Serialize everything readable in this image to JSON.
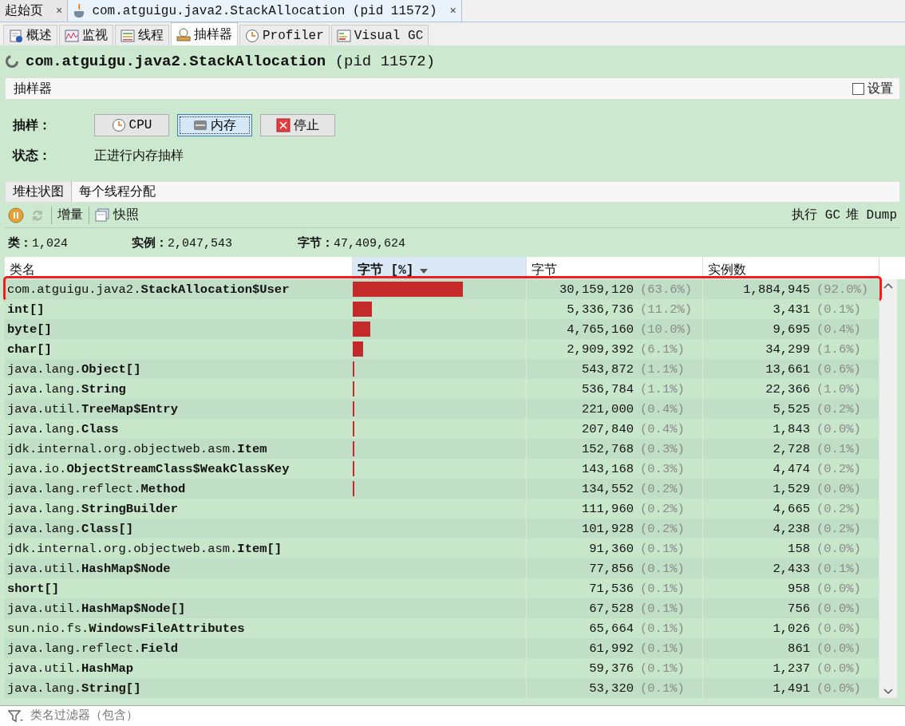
{
  "doc_tabs": [
    {
      "label": "起始页",
      "icon": false,
      "close": "×",
      "selected": false
    },
    {
      "label": "com.atguigu.java2.StackAllocation (pid 11572)",
      "icon": true,
      "close": "×",
      "selected": true
    }
  ],
  "view_tabs": [
    {
      "label": "概述",
      "kind": "info",
      "selected": false
    },
    {
      "label": "监视",
      "kind": "monitor",
      "selected": false
    },
    {
      "label": "线程",
      "kind": "threads",
      "selected": false
    },
    {
      "label": "抽样器",
      "kind": "sampler",
      "selected": true
    },
    {
      "label": "Profiler",
      "kind": "clock",
      "selected": false
    },
    {
      "label": "Visual GC",
      "kind": "gc",
      "selected": false
    }
  ],
  "title": "**com.atguigu.java2.StackAllocation** (pid 11572)",
  "section": {
    "title": "抽样器",
    "settings": {
      "label": "设置",
      "checked": false
    }
  },
  "sampling": {
    "label": "抽样：",
    "buttons": [
      {
        "label": "CPU",
        "kind": "cpu",
        "selected": false
      },
      {
        "label": "内存",
        "kind": "memory",
        "selected": true
      },
      {
        "label": "停止",
        "kind": "stop",
        "selected": false
      }
    ]
  },
  "status": {
    "label": "状态：",
    "value": "正进行内存抽样"
  },
  "result_tabs": [
    {
      "label": "堆柱状图",
      "selected": true
    },
    {
      "label": "每个线程分配",
      "selected": false
    }
  ],
  "toolbar": {
    "left": [
      {
        "kind": "pause",
        "disabled": false
      },
      {
        "kind": "refresh",
        "disabled": true
      },
      {
        "kind": "separator"
      },
      {
        "kind": "text",
        "label": "增量"
      },
      {
        "kind": "separator"
      },
      {
        "kind": "snapshot",
        "label": "快照"
      }
    ],
    "right": [
      "执行 GC",
      "堆 Dump"
    ]
  },
  "stats": [
    "**类：**1,024",
    "**实例：**2,047,543",
    "**字节：**47,409,624"
  ],
  "table": {
    "columns": [
      {
        "label": "类名",
        "sorted": false
      },
      {
        "label": "字节 [%]",
        "sorted": true
      },
      {
        "label": "字节",
        "sorted": false
      },
      {
        "label": "实例数",
        "sorted": false
      }
    ],
    "rows": [
      {
        "name": "com.atguigu.java2.**StackAllocation$User**",
        "level": 0.636,
        "bytes": "30,159,120",
        "bytes_pct": "(63.6%)",
        "instances": "1,884,945",
        "instances_pct": "(92.0%)",
        "highlighted": true
      },
      {
        "name": "**int[]**",
        "level": 0.112,
        "bytes": "5,336,736",
        "bytes_pct": "(11.2%)",
        "instances": "3,431",
        "instances_pct": "(0.1%)",
        "highlighted": false
      },
      {
        "name": "**byte[]**",
        "level": 0.1,
        "bytes": "4,765,160",
        "bytes_pct": "(10.0%)",
        "instances": "9,695",
        "instances_pct": "(0.4%)",
        "highlighted": false
      },
      {
        "name": "**char[]**",
        "level": 0.061,
        "bytes": "2,909,392",
        "bytes_pct": "(6.1%)",
        "instances": "34,299",
        "instances_pct": "(1.6%)",
        "highlighted": false
      },
      {
        "name": "java.lang.**Object[]**",
        "level": 0.011,
        "bytes": "543,872",
        "bytes_pct": "(1.1%)",
        "instances": "13,661",
        "instances_pct": "(0.6%)",
        "highlighted": false
      },
      {
        "name": "java.lang.**String**",
        "level": 0.011,
        "bytes": "536,784",
        "bytes_pct": "(1.1%)",
        "instances": "22,366",
        "instances_pct": "(1.0%)",
        "highlighted": false
      },
      {
        "name": "java.util.**TreeMap$Entry**",
        "level": 0.004,
        "bytes": "221,000",
        "bytes_pct": "(0.4%)",
        "instances": "5,525",
        "instances_pct": "(0.2%)",
        "highlighted": false
      },
      {
        "name": "java.lang.**Class**",
        "level": 0.004,
        "bytes": "207,840",
        "bytes_pct": "(0.4%)",
        "instances": "1,843",
        "instances_pct": "(0.0%)",
        "highlighted": false
      },
      {
        "name": "jdk.internal.org.objectweb.asm.**Item**",
        "level": 0.003,
        "bytes": "152,768",
        "bytes_pct": "(0.3%)",
        "instances": "2,728",
        "instances_pct": "(0.1%)",
        "highlighted": false
      },
      {
        "name": "java.io.**ObjectStreamClass$WeakClassKey**",
        "level": 0.003,
        "bytes": "143,168",
        "bytes_pct": "(0.3%)",
        "instances": "4,474",
        "instances_pct": "(0.2%)",
        "highlighted": false
      },
      {
        "name": "java.lang.reflect.**Method**",
        "level": 0.002,
        "bytes": "134,552",
        "bytes_pct": "(0.2%)",
        "instances": "1,529",
        "instances_pct": "(0.0%)",
        "highlighted": false
      },
      {
        "name": "java.lang.**StringBuilder**",
        "bytes": "111,960",
        "bytes_pct": "(0.2%)",
        "instances": "4,665",
        "instances_pct": "(0.2%)",
        "highlighted": false
      },
      {
        "name": "java.lang.**Class[]**",
        "bytes": "101,928",
        "bytes_pct": "(0.2%)",
        "instances": "4,238",
        "instances_pct": "(0.2%)",
        "highlighted": false
      },
      {
        "name": "jdk.internal.org.objectweb.asm.**Item[]**",
        "bytes": "91,360",
        "bytes_pct": "(0.1%)",
        "instances": "158",
        "instances_pct": "(0.0%)",
        "highlighted": false
      },
      {
        "name": "java.util.**HashMap$Node**",
        "bytes": "77,856",
        "bytes_pct": "(0.1%)",
        "instances": "2,433",
        "instances_pct": "(0.1%)",
        "highlighted": false
      },
      {
        "name": "**short[]**",
        "bytes": "71,536",
        "bytes_pct": "(0.1%)",
        "instances": "958",
        "instances_pct": "(0.0%)",
        "highlighted": false
      },
      {
        "name": "java.util.**HashMap$Node[]**",
        "bytes": "67,528",
        "bytes_pct": "(0.1%)",
        "instances": "756",
        "instances_pct": "(0.0%)",
        "highlighted": false
      },
      {
        "name": "sun.nio.fs.**WindowsFileAttributes**",
        "bytes": "65,664",
        "bytes_pct": "(0.1%)",
        "instances": "1,026",
        "instances_pct": "(0.0%)",
        "highlighted": false
      },
      {
        "name": "java.lang.reflect.**Field**",
        "bytes": "61,992",
        "bytes_pct": "(0.1%)",
        "instances": "861",
        "instances_pct": "(0.0%)",
        "highlighted": false
      },
      {
        "name": "java.util.**HashMap**",
        "bytes": "59,376",
        "bytes_pct": "(0.1%)",
        "instances": "1,237",
        "instances_pct": "(0.0%)",
        "highlighted": false
      },
      {
        "name": "java.lang.**String[]**",
        "bytes": "53,320",
        "bytes_pct": "(0.1%)",
        "instances": "1,491",
        "instances_pct": "(0.0%)",
        "highlighted": false
      }
    ]
  },
  "filter": {
    "placeholder": "类名过滤器（包含）"
  }
}
